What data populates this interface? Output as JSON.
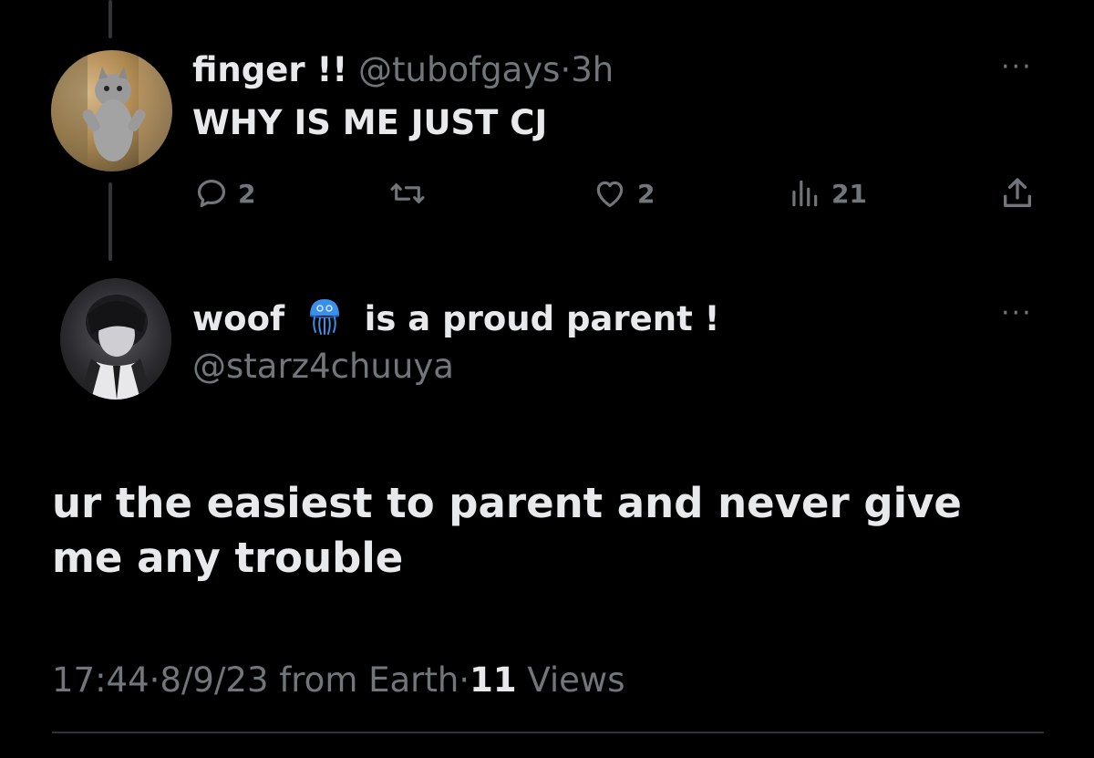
{
  "reply_to": {
    "display_name": "finger !!",
    "handle": "@tubofgays",
    "separator": "·",
    "time": "3h",
    "text": "WHY IS ME JUST CJ",
    "more": "···",
    "actions": {
      "reply_count": "2",
      "retweet_count": "",
      "like_count": "2",
      "views_count": "21"
    }
  },
  "main": {
    "display_name_prefix": "woof",
    "emoji": "🪼",
    "display_name_suffix": "is a proud parent !",
    "handle": "@starz4chuuya",
    "more": "···",
    "text": "ur the easiest to parent and never give me any trouble",
    "time": "17:44",
    "separator": "·",
    "date": "8/9/23 from Earth",
    "separator2": "·",
    "views_count": "11",
    "views_label": "Views"
  },
  "colors": {
    "background": "#000000",
    "text_primary": "#e7e9ea",
    "text_secondary": "#71767b",
    "divider": "#2f3336"
  }
}
